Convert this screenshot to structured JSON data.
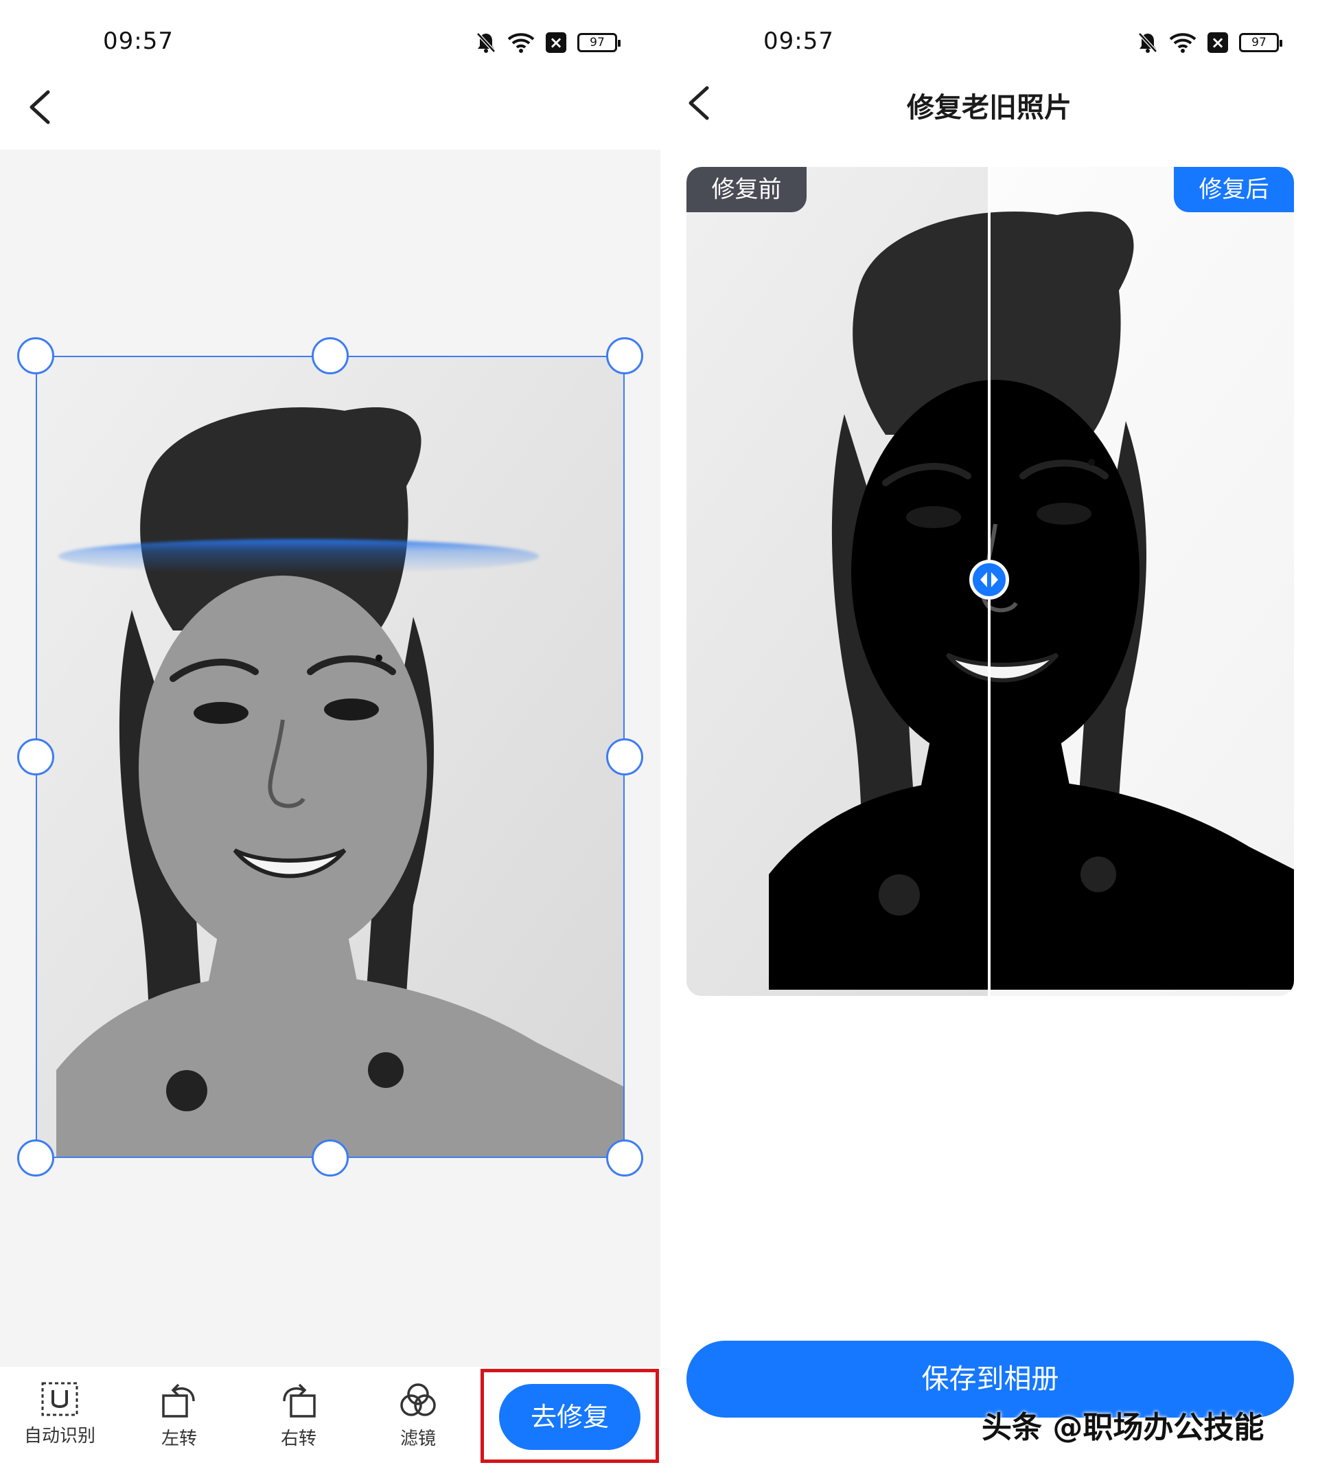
{
  "left_screen": {
    "status_bar": {
      "time": "09:57",
      "battery": "97"
    },
    "toolbar": {
      "auto_detect_label": "自动识别",
      "rotate_left_label": "左转",
      "rotate_right_label": "右转",
      "filter_label": "滤镜",
      "repair_button_label": "去修复"
    },
    "colors": {
      "accent": "#1677ff",
      "crop_frame": "#3d7cf2",
      "highlight": "#d6141b"
    }
  },
  "right_screen": {
    "status_bar": {
      "time": "09:57",
      "battery": "97"
    },
    "title": "修复老旧照片",
    "compare": {
      "before_label": "修复前",
      "after_label": "修复后"
    },
    "save_button_label": "保存到相册",
    "watermark": "头条 @职场办公技能"
  }
}
